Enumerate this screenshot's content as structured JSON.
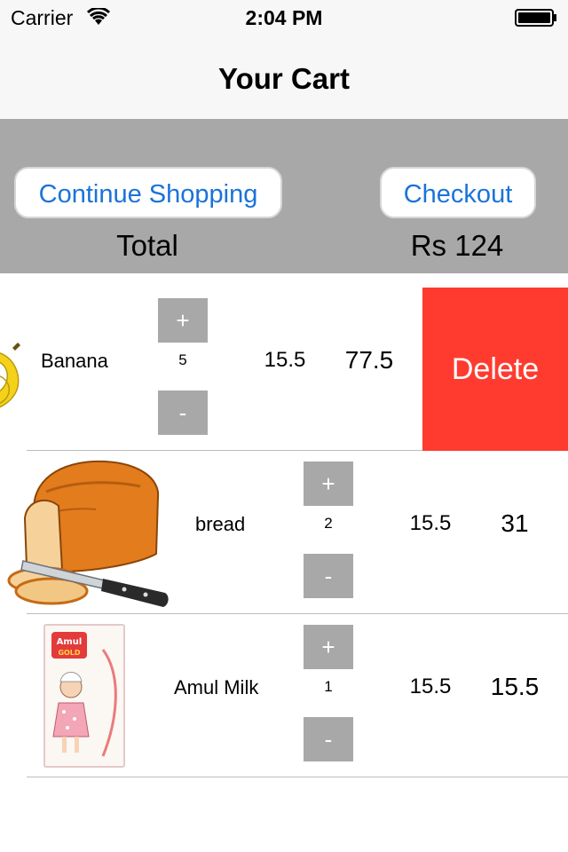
{
  "status_bar": {
    "carrier": "Carrier",
    "time": "2:04 PM"
  },
  "nav": {
    "title": "Your Cart"
  },
  "summary": {
    "continue_label": "Continue Shopping",
    "checkout_label": "Checkout",
    "total_label": "Total",
    "total_value": "Rs 124"
  },
  "items": [
    {
      "name": "Banana",
      "quantity": "5",
      "price": "15.5",
      "subtotal": "77.5",
      "image": "banana-icon"
    },
    {
      "name": "bread",
      "quantity": "2",
      "price": "15.5",
      "subtotal": "31",
      "image": "bread-icon"
    },
    {
      "name": "Amul Milk",
      "quantity": "1",
      "price": "15.5",
      "subtotal": "15.5",
      "image": "milk-carton-icon"
    }
  ],
  "stepper": {
    "plus": "+",
    "minus": "-"
  },
  "row_actions": {
    "delete_label": "Delete"
  },
  "colors": {
    "accent": "#1a73d9",
    "delete": "#ff3b30",
    "summary_bg": "#a8a8a8"
  }
}
